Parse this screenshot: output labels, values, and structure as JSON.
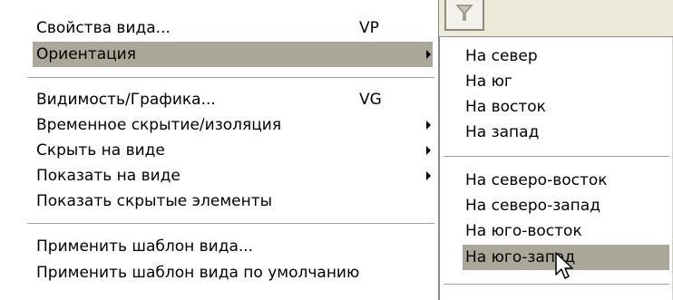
{
  "main_menu": {
    "items": [
      {
        "label": "Свойства вида...",
        "shortcut": "VP"
      },
      {
        "label": "Ориентация",
        "shortcut": ""
      },
      {
        "label": "Видимость/Графика...",
        "shortcut": "VG"
      },
      {
        "label": "Временное скрытие/изоляция",
        "shortcut": ""
      },
      {
        "label": "Скрыть на виде",
        "shortcut": ""
      },
      {
        "label": "Показать на виде",
        "shortcut": ""
      },
      {
        "label": "Показать скрытые элементы",
        "shortcut": ""
      },
      {
        "label": "Применить шаблон вида...",
        "shortcut": ""
      },
      {
        "label": "Применить шаблон вида по умолчанию",
        "shortcut": ""
      }
    ],
    "highlighted_item": "Ориентация"
  },
  "orientation_submenu": {
    "items": [
      {
        "label": "На север"
      },
      {
        "label": "На юг"
      },
      {
        "label": "На восток"
      },
      {
        "label": "На запад"
      },
      {
        "label": "На северо-восток"
      },
      {
        "label": "На северо-запад"
      },
      {
        "label": "На юго-восток"
      },
      {
        "label": "На юго-запад"
      }
    ],
    "highlighted_item": "На юго-запад"
  },
  "icons": {
    "toolbar_button": "funnel-icon",
    "submenu_arrow": "chevron-right-icon",
    "cursor": "mouse-pointer-icon"
  },
  "colors": {
    "highlight": "#aca899",
    "menu_background": "#ffffff",
    "toolbar_background": "#ece9d8",
    "border": "#8c8c8c"
  }
}
